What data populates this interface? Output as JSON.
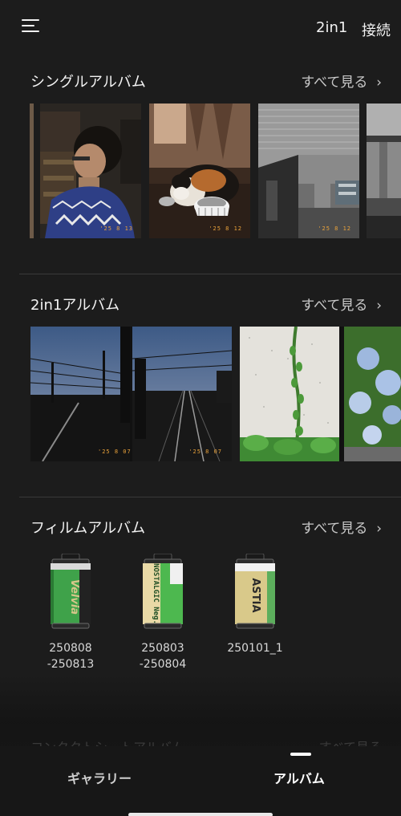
{
  "header": {
    "menu_icon": "hamburger-menu-icon",
    "action_2in1": "2in1",
    "action_connect": "接続"
  },
  "sections": {
    "single": {
      "title": "シングルアルバム",
      "see_all": "すべて見る",
      "chevron": "›"
    },
    "twoinone": {
      "title": "2in1アルバム",
      "see_all": "すべて見る",
      "chevron": "›"
    },
    "film": {
      "title": "フィルムアルバム",
      "see_all": "すべて見る",
      "chevron": "›"
    },
    "contact_hidden": {
      "title": "コンタクトシートアルバム",
      "see_all": "すべて見る"
    }
  },
  "single_photos": [
    {
      "subject": "portrait-person-photo",
      "stamp": "'25 8 13"
    },
    {
      "subject": "calico-cat-photo",
      "stamp": "'25 8 12"
    },
    {
      "subject": "concrete-ceiling-photo",
      "stamp": "'25 8 12"
    },
    {
      "subject": "highway-pillar-photo",
      "stamp": ""
    }
  ],
  "twoinone_photos": [
    {
      "subject": "railway-dusk-photo",
      "stamp": "'25 8 07"
    },
    {
      "subject": "railway-tracks-photo",
      "stamp": "'25 8 07"
    },
    {
      "subject": "ivy-wall-photo",
      "stamp": ""
    },
    {
      "subject": "hydrangea-photo",
      "stamp": ""
    }
  ],
  "films": [
    {
      "brand": "Velvia",
      "label": "250808\n-250813",
      "label_line1": "250808",
      "label_line2": "-250813",
      "accent": "#3fa24a",
      "band": "#1e1e1e"
    },
    {
      "brand": "NOSTALGIC Neg.",
      "label_line1": "250803",
      "label_line2": "-250804",
      "accent": "#4db84f",
      "band": "#e9d9a6"
    },
    {
      "brand": "ASTIA",
      "label_line1": "250101_1",
      "label_line2": "",
      "accent": "#5cae5c",
      "band": "#d9c98a"
    }
  ],
  "tabs": {
    "gallery": "ギャラリー",
    "album": "アルバム"
  },
  "colors": {
    "background": "#1c1c1c",
    "date_stamp": "#e9a23b",
    "film_green": "#3fa24a"
  }
}
